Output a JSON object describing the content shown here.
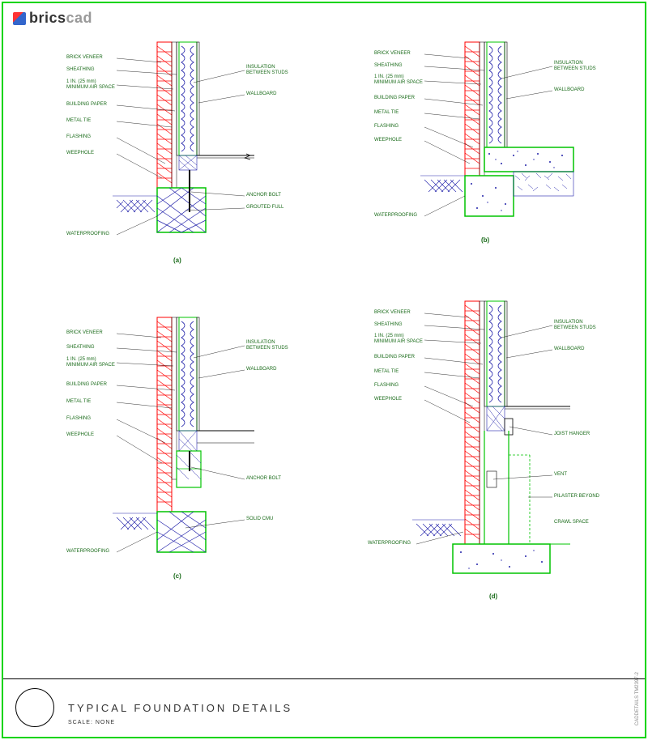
{
  "logo": {
    "brand": "brics",
    "suffix": "cad"
  },
  "details": {
    "a": {
      "figure": "(a)",
      "left_labels": [
        "BRICK VENEER",
        "SHEATHING",
        "1 IN. (25 mm)\nMINIMUM AIR SPACE",
        "BUILDING PAPER",
        "METAL TIE",
        "FLASHING",
        "WEEPHOLE"
      ],
      "right_labels": [
        "INSULATION\nBETWEEN STUDS",
        "WALLBOARD",
        "ANCHOR BOLT",
        "GROUTED FULL"
      ],
      "bottom_label": "WATERPROOFING"
    },
    "b": {
      "figure": "(b)",
      "left_labels": [
        "BRICK VENEER",
        "SHEATHING",
        "1 IN. (25 mm)\nMINIMUM AIR SPACE",
        "BUILDING PAPER",
        "METAL TIE",
        "FLASHING",
        "WEEPHOLE"
      ],
      "right_labels": [
        "INSULATION\nBETWEEN STUDS",
        "WALLBOARD"
      ],
      "bottom_label": "WATERPROOFING"
    },
    "c": {
      "figure": "(c)",
      "left_labels": [
        "BRICK VENEER",
        "SHEATHING",
        "1 IN. (25 mm)\nMINIMUM AIR SPACE",
        "BUILDING PAPER",
        "METAL TIE",
        "FLASHING",
        "WEEPHOLE"
      ],
      "right_labels": [
        "INSULATION\nBETWEEN STUDS",
        "WALLBOARD",
        "ANCHOR BOLT",
        "SOLID CMU"
      ],
      "bottom_label": "WATERPROOFING"
    },
    "d": {
      "figure": "(d)",
      "left_labels": [
        "BRICK VENEER",
        "SHEATHING",
        "1 IN. (25 mm)\nMINIMUM AIR SPACE",
        "BUILDING PAPER",
        "METAL TIE",
        "FLASHING",
        "WEEPHOLE"
      ],
      "right_labels": [
        "INSULATION\nBETWEEN STUDS",
        "WALLBOARD",
        "JOIST HANGER",
        "VENT",
        "PILASTER BEYOND",
        "CRAWL SPACE"
      ],
      "bottom_label": "WATERPROOFING"
    }
  },
  "title_block": {
    "title": "TYPICAL FOUNDATION DETAILS",
    "scale": "SCALE: NONE"
  },
  "side": "CADDETAILS         TM2397-2"
}
